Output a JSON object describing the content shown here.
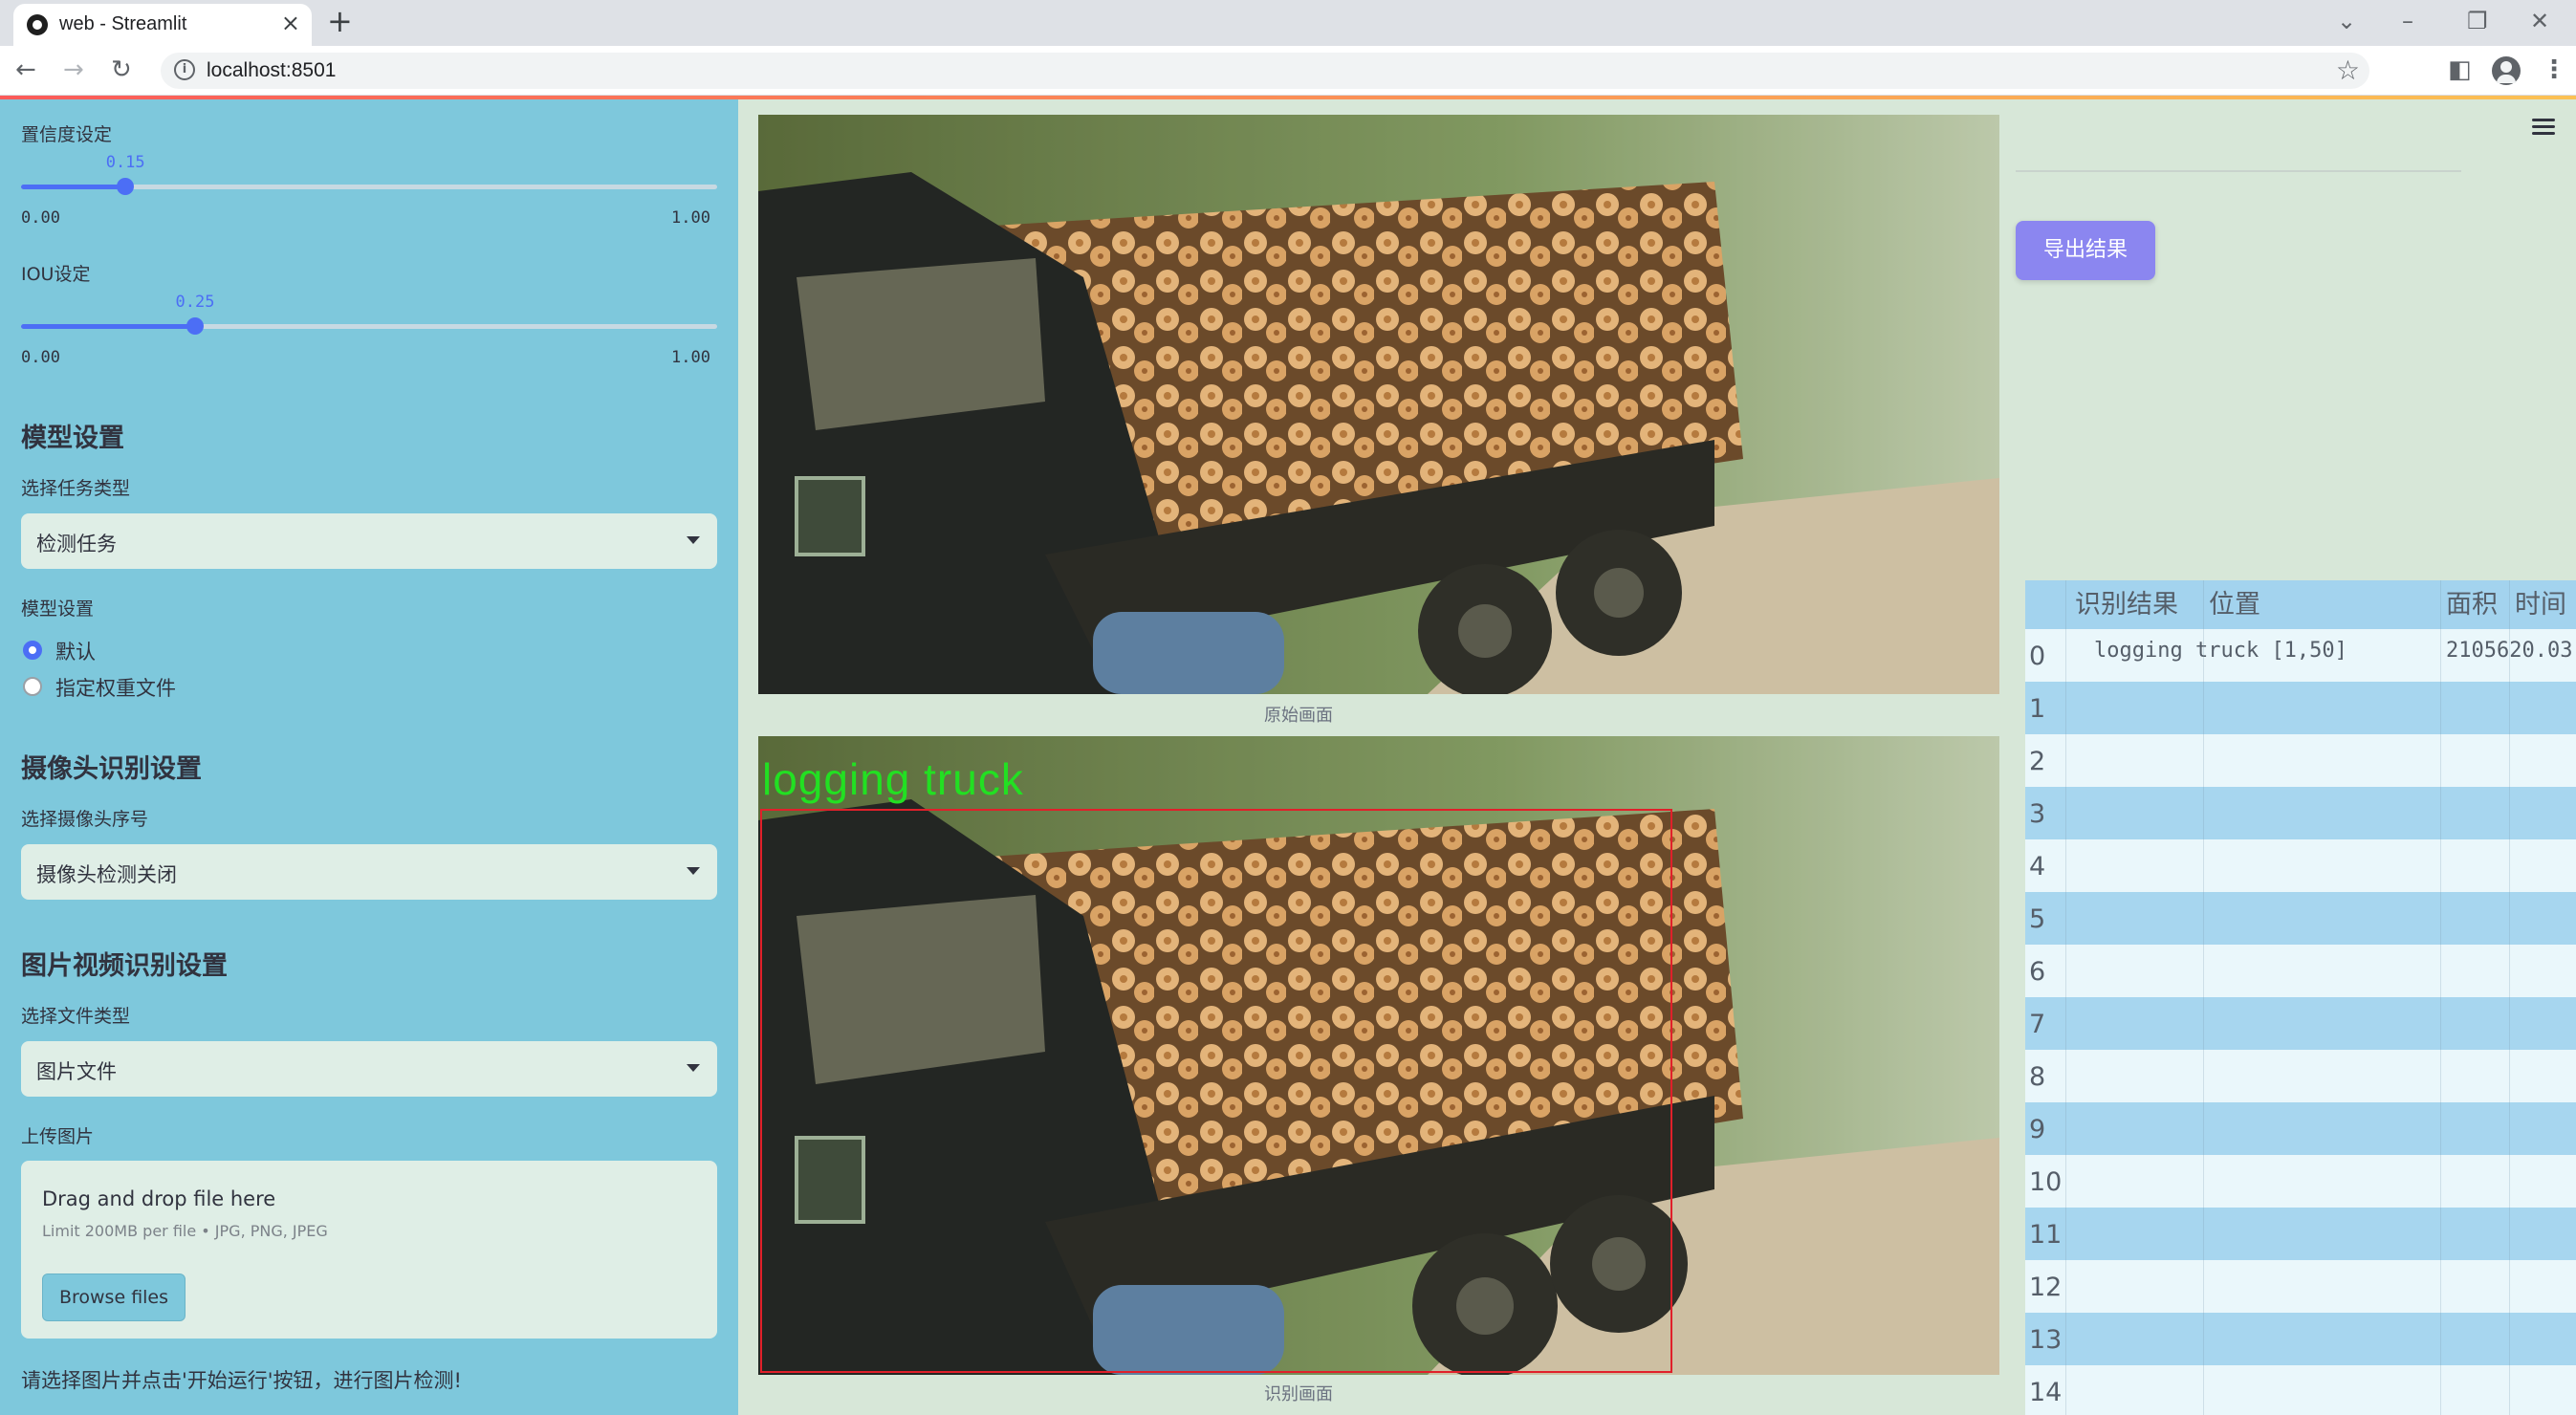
{
  "browser": {
    "tab_title": "web - Streamlit",
    "url": "localhost:8501"
  },
  "sidebar": {
    "confidence": {
      "label": "置信度设定",
      "value": "0.15",
      "value_num": 0.15,
      "min": "0.00",
      "max": "1.00"
    },
    "iou": {
      "label": "IOU设定",
      "value": "0.25",
      "value_num": 0.25,
      "min": "0.00",
      "max": "1.00"
    },
    "model_section": {
      "heading": "模型设置",
      "task_label": "选择任务类型",
      "task_value": "检测任务",
      "model_label": "模型设置",
      "options": [
        "默认",
        "指定权重文件"
      ],
      "selected_index": 0
    },
    "camera_section": {
      "heading": "摄像头识别设置",
      "camera_label": "选择摄像头序号",
      "camera_value": "摄像头检测关闭"
    },
    "file_section": {
      "heading": "图片视频识别设置",
      "type_label": "选择文件类型",
      "type_value": "图片文件",
      "upload_label": "上传图片",
      "drag_text": "Drag and drop file here",
      "limit_text": "Limit 200MB per file • JPG, PNG, JPEG",
      "browse_label": "Browse files"
    },
    "hint": "请选择图片并点击'开始运行'按钮，进行图片检测!"
  },
  "main": {
    "original_caption": "原始画面",
    "detected_caption": "识别画面",
    "detection_label": "logging truck"
  },
  "right_panel": {
    "export_label": "导出结果",
    "table": {
      "columns": [
        "识别结果",
        "位置",
        "面积",
        "时间"
      ],
      "rows": [
        {
          "index": "0",
          "result": "logging truck",
          "position": "[1,50]",
          "area": "2105620.0",
          "time": "3"
        },
        {
          "index": "1"
        },
        {
          "index": "2"
        },
        {
          "index": "3"
        },
        {
          "index": "4"
        },
        {
          "index": "5"
        },
        {
          "index": "6"
        },
        {
          "index": "7"
        },
        {
          "index": "8"
        },
        {
          "index": "9"
        },
        {
          "index": "10"
        },
        {
          "index": "11"
        },
        {
          "index": "12"
        },
        {
          "index": "13"
        },
        {
          "index": "14"
        }
      ]
    }
  },
  "colors": {
    "sidebar_bg": "#7ec8dc",
    "main_bg": "#d7e7d8",
    "accent": "#4c6ef5",
    "export_button": "#8b86f0",
    "detection_box": "#e0202a",
    "detection_label": "#22e022"
  }
}
